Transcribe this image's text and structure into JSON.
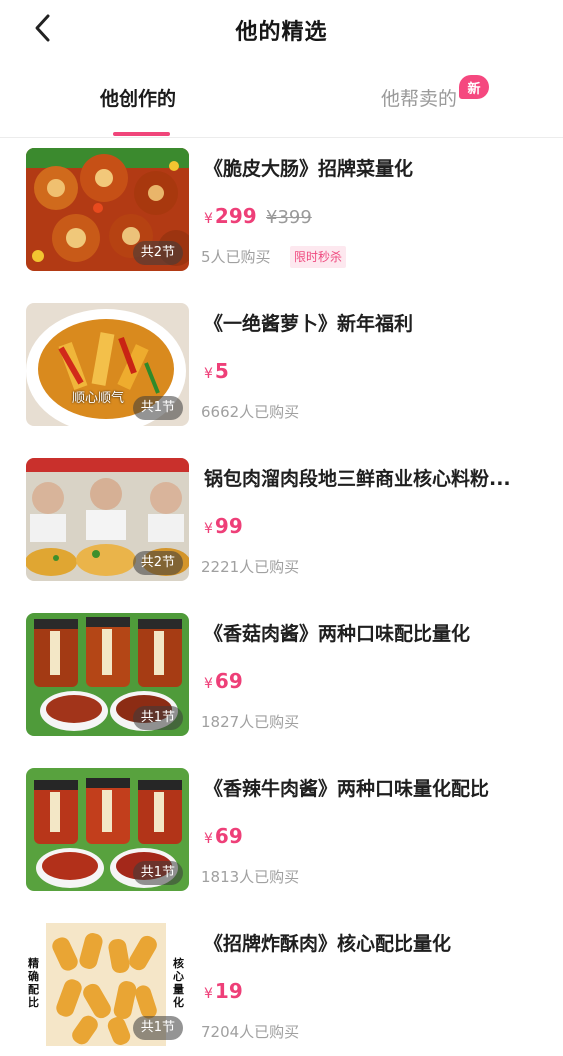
{
  "header": {
    "title": "他的精选"
  },
  "tabs": [
    {
      "label": "他创作的"
    },
    {
      "label": "他帮卖的",
      "badge": "新"
    }
  ],
  "currency_symbol": "¥",
  "items": [
    {
      "title": "《脆皮大肠》招牌菜量化",
      "price": "299",
      "original_price": "¥399",
      "sold": "5人已购买",
      "promo_tag": "限时秒杀",
      "sections": "共2节"
    },
    {
      "title": "《一绝酱萝卜》新年福利",
      "price": "5",
      "sold": "6662人已购买",
      "sections": "共1节",
      "thumb_caption": "顺心顺气"
    },
    {
      "title": "锅包肉溜肉段地三鲜商业核心料粉...",
      "price": "99",
      "sold": "2221人已购买",
      "sections": "共2节"
    },
    {
      "title": "《香菇肉酱》两种口味配比量化",
      "price": "69",
      "sold": "1827人已购买",
      "sections": "共1节"
    },
    {
      "title": "《香辣牛肉酱》两种口味量化配比",
      "price": "69",
      "sold": "1813人已购买",
      "sections": "共1节"
    },
    {
      "title": "《招牌炸酥肉》核心配比量化",
      "price": "19",
      "sold": "7204人已购买",
      "sections": "共1节",
      "thumb_left": "精确配比",
      "thumb_right": "核心量化"
    }
  ]
}
